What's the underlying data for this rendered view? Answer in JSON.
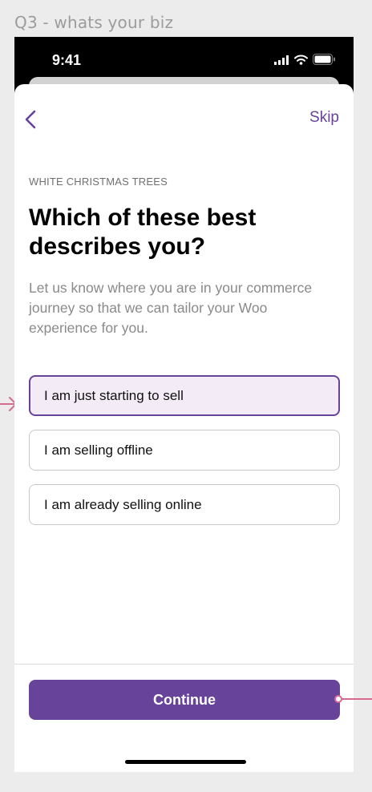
{
  "frame_label": "Q3 - whats your biz",
  "status_bar": {
    "time": "9:41",
    "icons": [
      "signal-icon",
      "wifi-icon",
      "battery-icon"
    ]
  },
  "nav": {
    "back_icon": "chevron-left-icon",
    "skip_label": "Skip"
  },
  "content": {
    "eyebrow": "WHITE CHRISTMAS TREES",
    "title": "Which of these best describes you?",
    "subtitle": "Let us know where you are in your commerce journey so that we can tailor your Woo experience for you."
  },
  "options": [
    {
      "label": "I am just starting to sell",
      "selected": true
    },
    {
      "label": "I am selling offline",
      "selected": false
    },
    {
      "label": "I am already selling online",
      "selected": false
    }
  ],
  "footer": {
    "continue_label": "Continue"
  },
  "colors": {
    "accent": "#674399",
    "selected_bg": "#f3ecf6",
    "annotation": "#d86a91",
    "canvas_bg": "#ececec"
  }
}
